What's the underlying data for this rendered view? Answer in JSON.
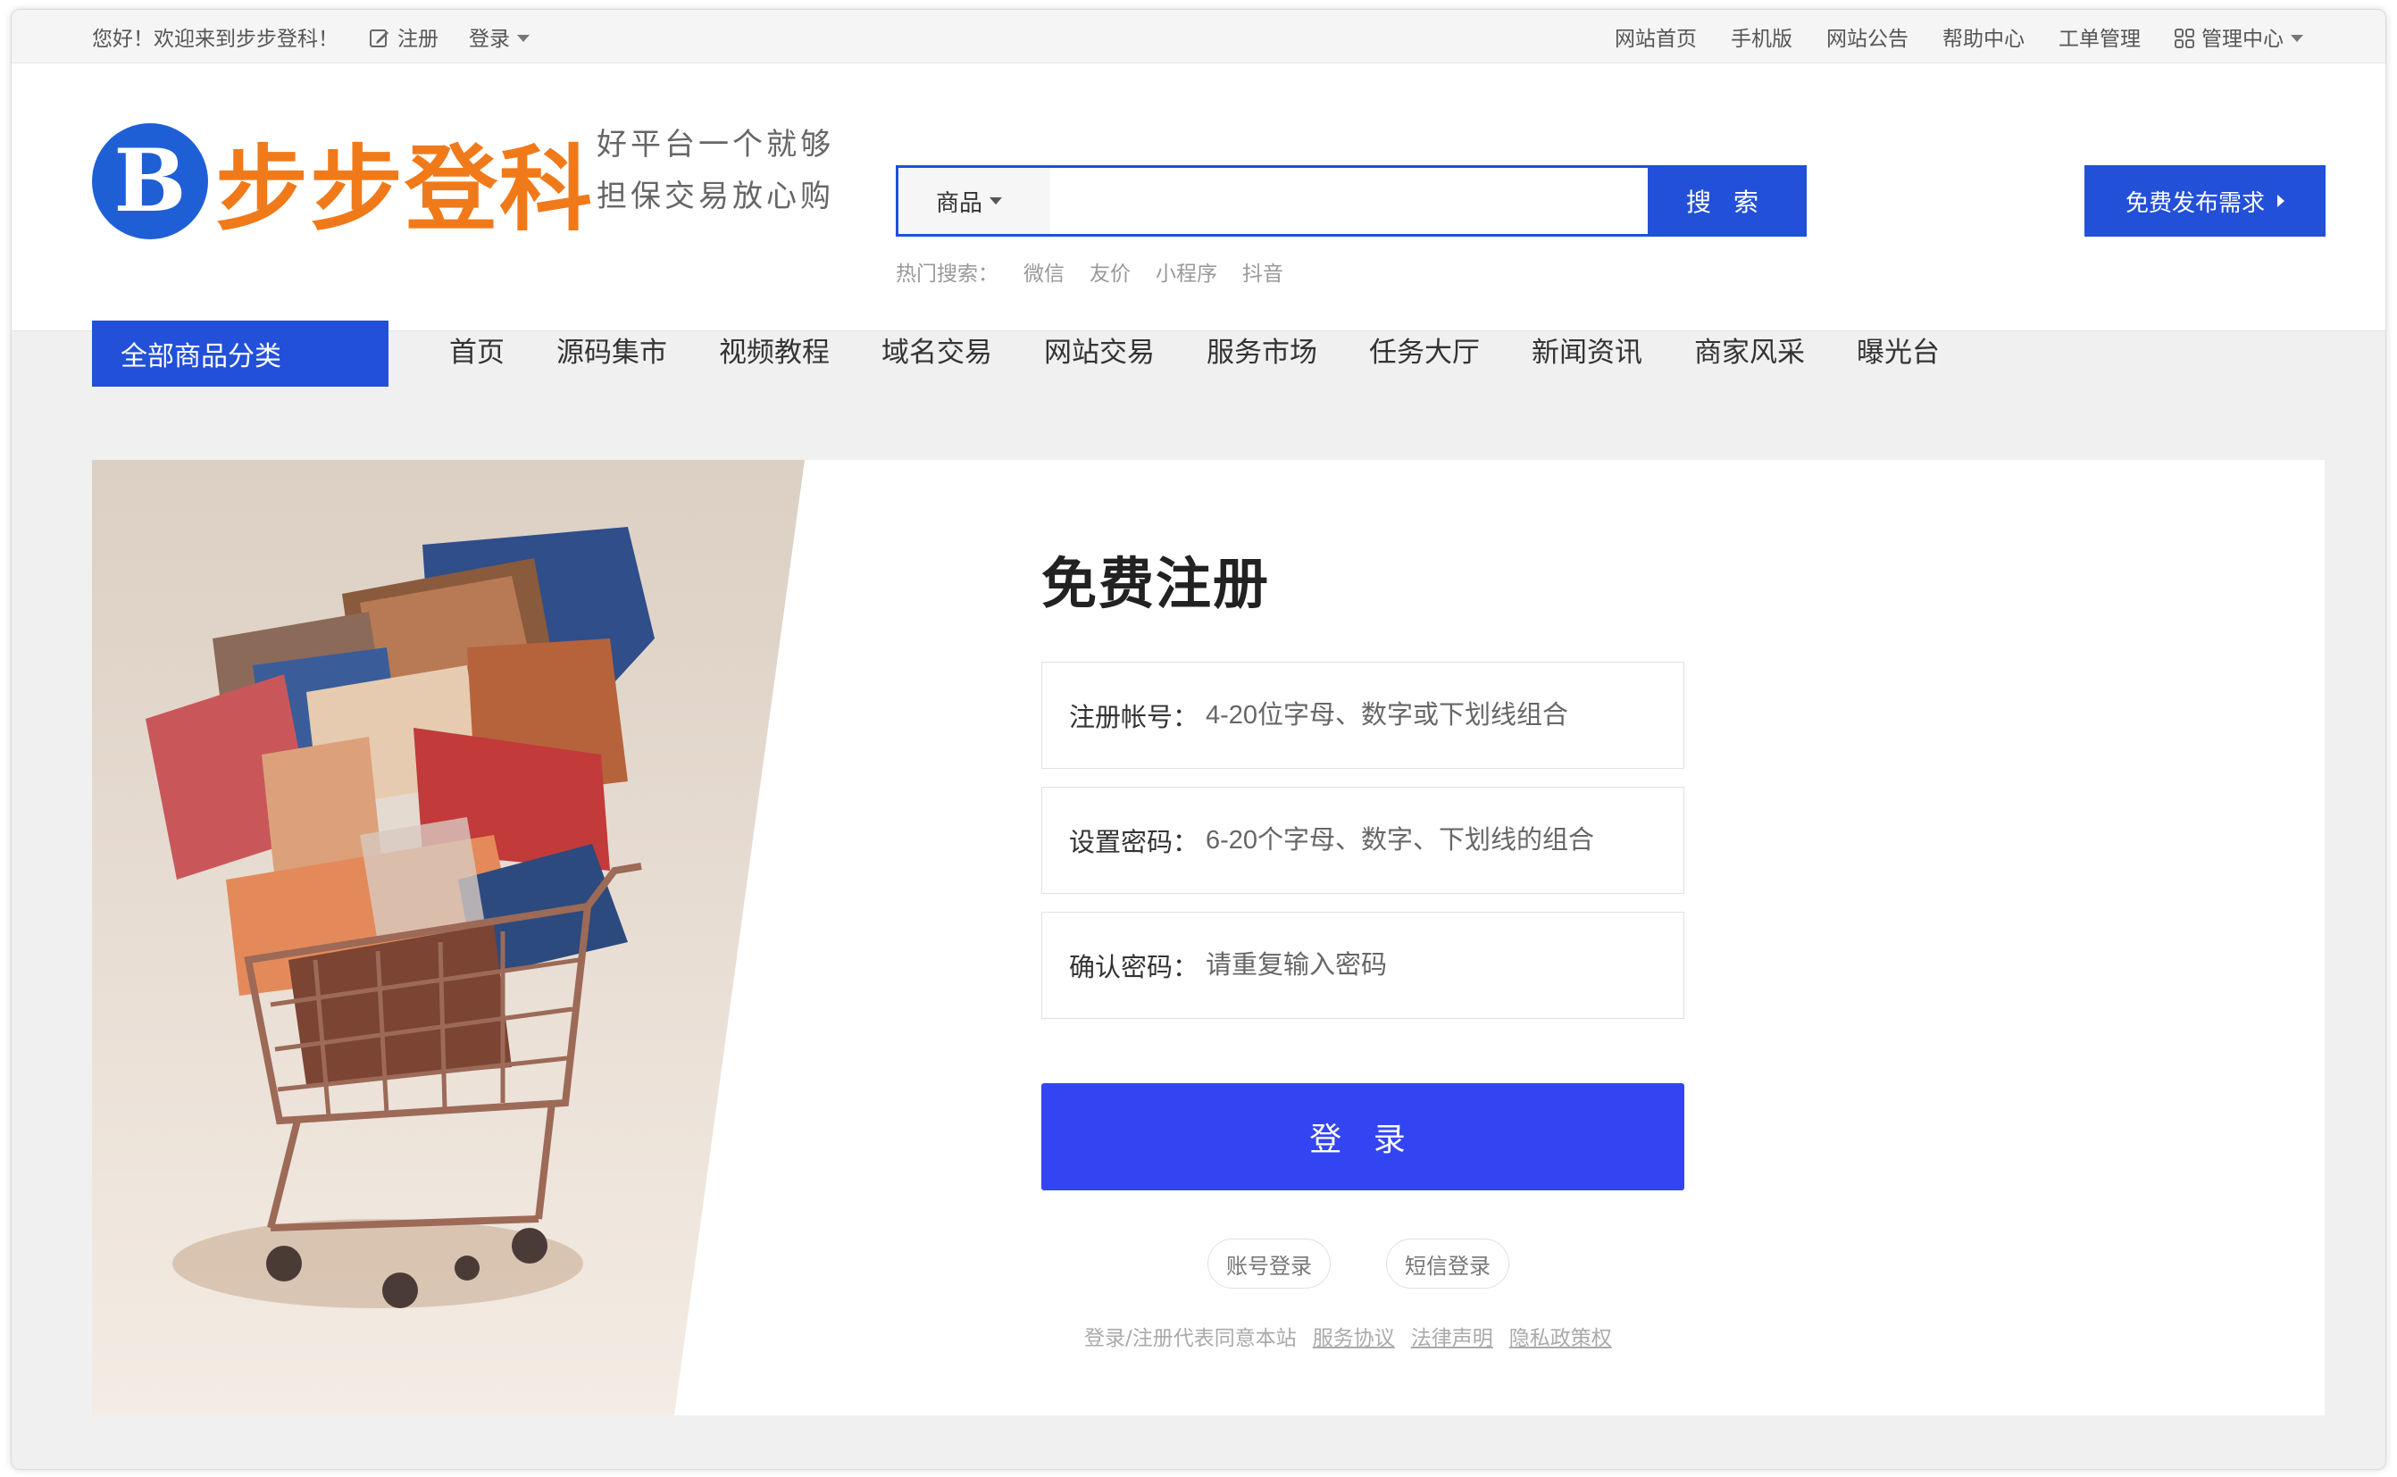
{
  "topbar": {
    "welcome": "您好！欢迎来到步步登科！",
    "register": "注册",
    "login": "登录",
    "links": [
      "网站首页",
      "手机版",
      "网站公告",
      "帮助中心",
      "工单管理"
    ],
    "admin": "管理中心"
  },
  "logo": {
    "badge": "B",
    "name": "步步登科"
  },
  "slogan": {
    "line1": "好平台一个就够",
    "line2": "担保交易放心购"
  },
  "search": {
    "category": "商品",
    "placeholder": "",
    "button": "搜 索",
    "hot_label": "热门搜索：",
    "hot_terms": [
      "微信",
      "友价",
      "小程序",
      "抖音"
    ]
  },
  "publish_button": "免费发布需求",
  "category_button": "全部商品分类",
  "nav": [
    "首页",
    "源码集市",
    "视频教程",
    "域名交易",
    "网站交易",
    "服务市场",
    "任务大厅",
    "新闻资讯",
    "商家风采",
    "曝光台"
  ],
  "form": {
    "title": "免费注册",
    "fields": [
      {
        "label": "注册帐号：",
        "placeholder": "4-20位字母、数字或下划线组合"
      },
      {
        "label": "设置密码：",
        "placeholder": "6-20个字母、数字、下划线的组合"
      },
      {
        "label": "确认密码：",
        "placeholder": "请重复输入密码"
      }
    ],
    "submit": "登 录",
    "alt_login": [
      "账号登录",
      "短信登录"
    ],
    "agreement_prefix": "登录/注册代表同意本站",
    "agreement_links": [
      "服务协议",
      "法律声明",
      "隐私政策权"
    ]
  },
  "colors": {
    "brand_blue": "#2250d8",
    "submit_blue": "#3345f2",
    "logo_orange": "#f07a1a"
  }
}
